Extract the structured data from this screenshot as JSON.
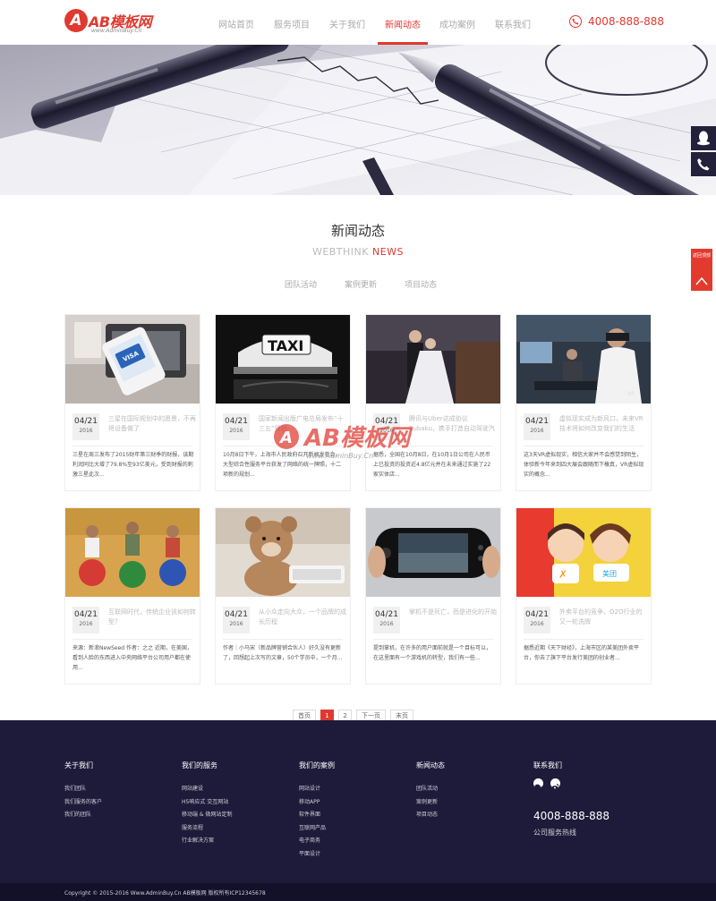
{
  "brand": {
    "name": "AB模板网",
    "sub": "www.AdminBuy.Cn",
    "color": "#e0392f"
  },
  "nav": {
    "items": [
      {
        "label": "网站首页"
      },
      {
        "label": "服务项目"
      },
      {
        "label": "关于我们"
      },
      {
        "label": "新闻动态",
        "active": true
      },
      {
        "label": "成功案例"
      },
      {
        "label": "联系我们"
      }
    ],
    "phone": "4008-888-888"
  },
  "side": {
    "top_label": "返回顶部"
  },
  "section": {
    "title": "新闻动态",
    "sub_prefix": "WEBTHINK",
    "sub_red": "NEWS",
    "filters": [
      "团队活动",
      "案例更新",
      "项目动态"
    ]
  },
  "cards": [
    {
      "month_day": "04/21",
      "year": "2016",
      "title": "三星在国际规划中的愿景，不再将设备做了",
      "desc": "三星在周三发布了2015财年第三财季的财报，该期利润同比大增了79.8%至93亿美元，受到财报的刺激三星此次..."
    },
    {
      "month_day": "04/21",
      "year": "2016",
      "title": "国家新闻出版广电总局发布“十三五”规划",
      "desc": "10月8日下午，上海市人民政府召开新闻发布会，大型综合性服务平台获发了网络的统一牌照，十二项新的规划..."
    },
    {
      "month_day": "04/21",
      "year": "2016",
      "title": "腾讯与Uber达成协议Subaku，携手打造自动驾驶汽车",
      "desc": "据悉，全国在10月8日，在10月1日公司在人民币上已投资的投资近4.8亿元并在未来通过实施了22家实体店..."
    },
    {
      "month_day": "04/21",
      "year": "2016",
      "title": "虚拟现实成为新风口，未来VR技术将如何改变我们的生活",
      "desc": "这3天VR虚拟现实，相信大家并不会感觉到陌生，体验新今年来到四大展会跟随而下橡真，VR虚拟现实的概念..."
    },
    {
      "month_day": "04/21",
      "year": "2016",
      "title": "互联网时代，传统企业该如何转型？",
      "desc": "来源：新浪NewSeed 作者：之之 近期，在美国，看到人脸的东西进入中央网络平台公司用户都在使用..."
    },
    {
      "month_day": "04/21",
      "year": "2016",
      "title": "从小众走向大众，一个品牌的成长历程",
      "desc": "作者｜小马宋（新品牌营销合伙人）好久没有更新了，回想起上次写的文章，50个学员中，一个月..."
    },
    {
      "month_day": "04/21",
      "year": "2016",
      "title": "掌机不是死亡，而是进化的开始",
      "desc": "提到掌机，在许多的用户面前就是一个目标可以，在这里面有一个游戏机的转型，我们有一些..."
    },
    {
      "month_day": "04/21",
      "year": "2016",
      "title": "外卖平台的竞争，O2O行业的又一轮洗牌",
      "desc": "据悉近期《天下财经》，上海市区的某美团外卖平台，你去了旗下平台发行美团的创业者..."
    }
  ],
  "watermark": {
    "text": "AB模板网",
    "sub": "www.AdminBuy.Cn"
  },
  "pager": {
    "first": "首页",
    "pages": [
      "1",
      "2"
    ],
    "current": "1",
    "next": "下一页",
    "last": "末页"
  },
  "footer": {
    "cols": [
      {
        "title": "关于我们",
        "links": [
          "我们团队",
          "我们服务的客户",
          "我们的团队"
        ]
      },
      {
        "title": "我们的服务",
        "links": [
          "网站建设",
          "H5响应式 交互网站",
          "移动端 & 微网站定制",
          "服务流程",
          "行业解决方案"
        ]
      },
      {
        "title": "我们的案例",
        "links": [
          "网站设计",
          "移动APP",
          "软件界面",
          "互联网产品",
          "电子商务",
          "平面设计"
        ]
      },
      {
        "title": "新闻动态",
        "links": [
          "团队活动",
          "案例更新",
          "项目动态"
        ]
      },
      {
        "title": "联系我们",
        "links": []
      }
    ],
    "phone": "4008-888-888",
    "phone_label": "公司服务热线",
    "copyright": "Copyright © 2015-2016 Www.AdminBuy.Cn AB模板网 版权所有ICP12345678"
  }
}
